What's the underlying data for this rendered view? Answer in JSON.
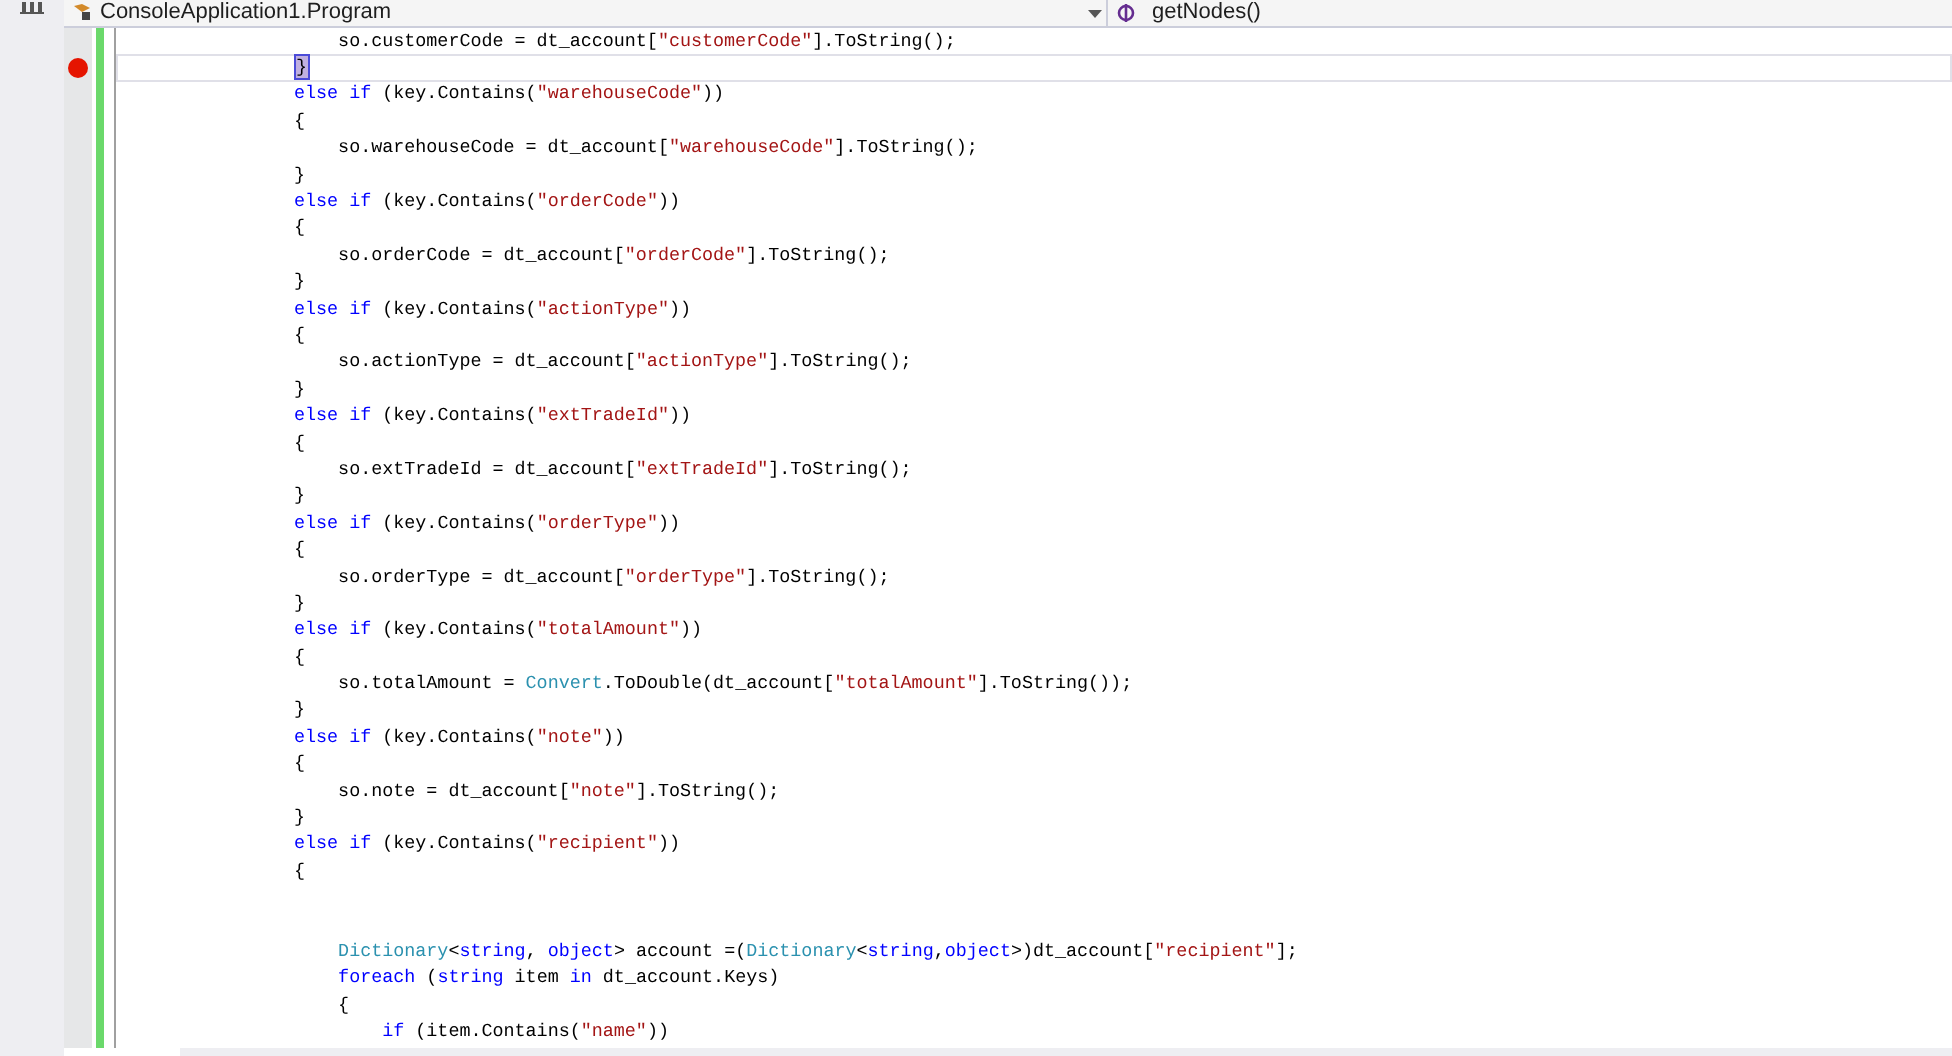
{
  "navigation_bar": {
    "type_dropdown": "ConsoleApplication1.Program",
    "member_dropdown": "getNodes()"
  },
  "lines": [
    {
      "breakpoint": false,
      "current": false,
      "tokens": [
        {
          "kind": "plain",
          "text": "    so.customerCode = dt_account["
        },
        {
          "kind": "string",
          "text": "\"customerCode\""
        },
        {
          "kind": "plain",
          "text": "].ToString();"
        }
      ]
    },
    {
      "breakpoint": true,
      "current": true,
      "tokens": [
        {
          "kind": "brace_match",
          "text": "}"
        }
      ]
    },
    {
      "breakpoint": false,
      "current": false,
      "tokens": [
        {
          "kind": "keyword",
          "text": "else if"
        },
        {
          "kind": "plain",
          "text": " (key.Contains("
        },
        {
          "kind": "string",
          "text": "\"warehouseCode\""
        },
        {
          "kind": "plain",
          "text": "))"
        }
      ]
    },
    {
      "breakpoint": false,
      "current": false,
      "tokens": [
        {
          "kind": "plain",
          "text": "{"
        }
      ]
    },
    {
      "breakpoint": false,
      "current": false,
      "tokens": [
        {
          "kind": "plain",
          "text": "    so.warehouseCode = dt_account["
        },
        {
          "kind": "string",
          "text": "\"warehouseCode\""
        },
        {
          "kind": "plain",
          "text": "].ToString();"
        }
      ]
    },
    {
      "breakpoint": false,
      "current": false,
      "tokens": [
        {
          "kind": "plain",
          "text": "}"
        }
      ]
    },
    {
      "breakpoint": false,
      "current": false,
      "tokens": [
        {
          "kind": "keyword",
          "text": "else if"
        },
        {
          "kind": "plain",
          "text": " (key.Contains("
        },
        {
          "kind": "string",
          "text": "\"orderCode\""
        },
        {
          "kind": "plain",
          "text": "))"
        }
      ]
    },
    {
      "breakpoint": false,
      "current": false,
      "tokens": [
        {
          "kind": "plain",
          "text": "{"
        }
      ]
    },
    {
      "breakpoint": false,
      "current": false,
      "tokens": [
        {
          "kind": "plain",
          "text": "    so.orderCode = dt_account["
        },
        {
          "kind": "string",
          "text": "\"orderCode\""
        },
        {
          "kind": "plain",
          "text": "].ToString();"
        }
      ]
    },
    {
      "breakpoint": false,
      "current": false,
      "tokens": [
        {
          "kind": "plain",
          "text": "}"
        }
      ]
    },
    {
      "breakpoint": false,
      "current": false,
      "tokens": [
        {
          "kind": "keyword",
          "text": "else if"
        },
        {
          "kind": "plain",
          "text": " (key.Contains("
        },
        {
          "kind": "string",
          "text": "\"actionType\""
        },
        {
          "kind": "plain",
          "text": "))"
        }
      ]
    },
    {
      "breakpoint": false,
      "current": false,
      "tokens": [
        {
          "kind": "plain",
          "text": "{"
        }
      ]
    },
    {
      "breakpoint": false,
      "current": false,
      "tokens": [
        {
          "kind": "plain",
          "text": "    so.actionType = dt_account["
        },
        {
          "kind": "string",
          "text": "\"actionType\""
        },
        {
          "kind": "plain",
          "text": "].ToString();"
        }
      ]
    },
    {
      "breakpoint": false,
      "current": false,
      "tokens": [
        {
          "kind": "plain",
          "text": "}"
        }
      ]
    },
    {
      "breakpoint": false,
      "current": false,
      "tokens": [
        {
          "kind": "keyword",
          "text": "else if"
        },
        {
          "kind": "plain",
          "text": " (key.Contains("
        },
        {
          "kind": "string",
          "text": "\"extTradeId\""
        },
        {
          "kind": "plain",
          "text": "))"
        }
      ]
    },
    {
      "breakpoint": false,
      "current": false,
      "tokens": [
        {
          "kind": "plain",
          "text": "{"
        }
      ]
    },
    {
      "breakpoint": false,
      "current": false,
      "tokens": [
        {
          "kind": "plain",
          "text": "    so.extTradeId = dt_account["
        },
        {
          "kind": "string",
          "text": "\"extTradeId\""
        },
        {
          "kind": "plain",
          "text": "].ToString();"
        }
      ]
    },
    {
      "breakpoint": false,
      "current": false,
      "tokens": [
        {
          "kind": "plain",
          "text": "}"
        }
      ]
    },
    {
      "breakpoint": false,
      "current": false,
      "tokens": [
        {
          "kind": "keyword",
          "text": "else if"
        },
        {
          "kind": "plain",
          "text": " (key.Contains("
        },
        {
          "kind": "string",
          "text": "\"orderType\""
        },
        {
          "kind": "plain",
          "text": "))"
        }
      ]
    },
    {
      "breakpoint": false,
      "current": false,
      "tokens": [
        {
          "kind": "plain",
          "text": "{"
        }
      ]
    },
    {
      "breakpoint": false,
      "current": false,
      "tokens": [
        {
          "kind": "plain",
          "text": "    so.orderType = dt_account["
        },
        {
          "kind": "string",
          "text": "\"orderType\""
        },
        {
          "kind": "plain",
          "text": "].ToString();"
        }
      ]
    },
    {
      "breakpoint": false,
      "current": false,
      "tokens": [
        {
          "kind": "plain",
          "text": "}"
        }
      ]
    },
    {
      "breakpoint": false,
      "current": false,
      "tokens": [
        {
          "kind": "keyword",
          "text": "else if"
        },
        {
          "kind": "plain",
          "text": " (key.Contains("
        },
        {
          "kind": "string",
          "text": "\"totalAmount\""
        },
        {
          "kind": "plain",
          "text": "))"
        }
      ]
    },
    {
      "breakpoint": false,
      "current": false,
      "tokens": [
        {
          "kind": "plain",
          "text": "{"
        }
      ]
    },
    {
      "breakpoint": false,
      "current": false,
      "tokens": [
        {
          "kind": "plain",
          "text": "    so.totalAmount = "
        },
        {
          "kind": "type",
          "text": "Convert"
        },
        {
          "kind": "plain",
          "text": ".ToDouble(dt_account["
        },
        {
          "kind": "string",
          "text": "\"totalAmount\""
        },
        {
          "kind": "plain",
          "text": "].ToString());"
        }
      ]
    },
    {
      "breakpoint": false,
      "current": false,
      "tokens": [
        {
          "kind": "plain",
          "text": "}"
        }
      ]
    },
    {
      "breakpoint": false,
      "current": false,
      "tokens": [
        {
          "kind": "keyword",
          "text": "else if"
        },
        {
          "kind": "plain",
          "text": " (key.Contains("
        },
        {
          "kind": "string",
          "text": "\"note\""
        },
        {
          "kind": "plain",
          "text": "))"
        }
      ]
    },
    {
      "breakpoint": false,
      "current": false,
      "tokens": [
        {
          "kind": "plain",
          "text": "{"
        }
      ]
    },
    {
      "breakpoint": false,
      "current": false,
      "tokens": [
        {
          "kind": "plain",
          "text": "    so.note = dt_account["
        },
        {
          "kind": "string",
          "text": "\"note\""
        },
        {
          "kind": "plain",
          "text": "].ToString();"
        }
      ]
    },
    {
      "breakpoint": false,
      "current": false,
      "tokens": [
        {
          "kind": "plain",
          "text": "}"
        }
      ]
    },
    {
      "breakpoint": false,
      "current": false,
      "tokens": [
        {
          "kind": "keyword",
          "text": "else if"
        },
        {
          "kind": "plain",
          "text": " (key.Contains("
        },
        {
          "kind": "string",
          "text": "\"recipient\""
        },
        {
          "kind": "plain",
          "text": "))"
        }
      ]
    },
    {
      "breakpoint": false,
      "current": false,
      "tokens": [
        {
          "kind": "plain",
          "text": "{"
        }
      ]
    },
    {
      "breakpoint": false,
      "current": false
    },
    {
      "breakpoint": false,
      "current": false
    },
    {
      "breakpoint": false,
      "current": false,
      "tokens": [
        {
          "kind": "type",
          "text": "    Dictionary"
        },
        {
          "kind": "plain",
          "text": "<"
        },
        {
          "kind": "keyword",
          "text": "string"
        },
        {
          "kind": "plain",
          "text": ", "
        },
        {
          "kind": "keyword",
          "text": "object"
        },
        {
          "kind": "plain",
          "text": "> account =("
        },
        {
          "kind": "type",
          "text": "Dictionary"
        },
        {
          "kind": "plain",
          "text": "<"
        },
        {
          "kind": "keyword",
          "text": "string"
        },
        {
          "kind": "plain",
          "text": ","
        },
        {
          "kind": "keyword",
          "text": "object"
        },
        {
          "kind": "plain",
          "text": ">)dt_account["
        },
        {
          "kind": "string",
          "text": "\"recipient\""
        },
        {
          "kind": "plain",
          "text": "];"
        }
      ]
    },
    {
      "breakpoint": false,
      "current": false,
      "tokens": [
        {
          "kind": "keyword",
          "text": "    foreach"
        },
        {
          "kind": "plain",
          "text": " ("
        },
        {
          "kind": "keyword",
          "text": "string"
        },
        {
          "kind": "plain",
          "text": " item "
        },
        {
          "kind": "keyword",
          "text": "in"
        },
        {
          "kind": "plain",
          "text": " dt_account.Keys)"
        }
      ]
    },
    {
      "breakpoint": false,
      "current": false,
      "tokens": [
        {
          "kind": "plain",
          "text": "    {"
        }
      ]
    },
    {
      "breakpoint": false,
      "current": false,
      "tokens": [
        {
          "kind": "keyword",
          "text": "        if"
        },
        {
          "kind": "plain",
          "text": " (item.Contains("
        },
        {
          "kind": "string",
          "text": "\"name\""
        },
        {
          "kind": "plain",
          "text": "))"
        }
      ]
    }
  ]
}
